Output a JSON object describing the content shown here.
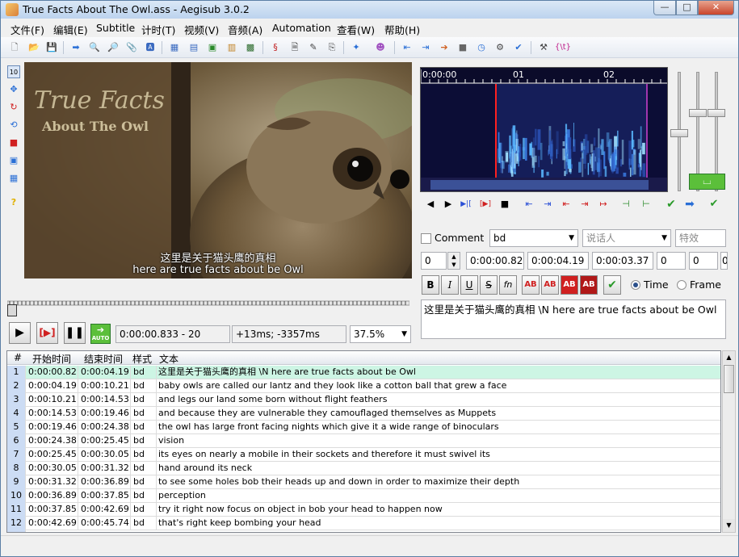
{
  "window": {
    "title": "True Facts About The Owl.ass - Aegisub 3.0.2"
  },
  "menu": [
    "文件(F)",
    "编辑(E)",
    "Subtitle",
    "计时(T)",
    "视频(V)",
    "音频(A)",
    "Automation",
    "查看(W)",
    "帮助(H)"
  ],
  "video": {
    "logo_line1": "True Facts",
    "logo_line2": "About The Owl",
    "subtitle_line1": "这里是关于猫头鹰的真相",
    "subtitle_line2": "here are true facts about be Owl",
    "time_display": "0:00:00.833 - 20",
    "offset_display": "+13ms; -3357ms",
    "zoom": "37.5%",
    "auto_label": "AUTO"
  },
  "audio": {
    "ticks": [
      "0:00:00",
      "01",
      "02"
    ]
  },
  "editor": {
    "comment_label": "Comment",
    "style": "bd",
    "actor_placeholder": "说话人",
    "effect_placeholder": "特效",
    "layer": "0",
    "start": "0:00:00.82",
    "end": "0:00:04.19",
    "duration": "0:00:03.37",
    "margin_l": "0",
    "margin_r": "0",
    "margin_v": "0",
    "bold": "B",
    "italic": "I",
    "underline": "U",
    "strike": "S",
    "font": "fn",
    "ab": "AB",
    "time_label": "Time",
    "frame_label": "Frame",
    "text": "这里是关于猫头鹰的真相 \\N here are true facts about be Owl"
  },
  "grid": {
    "headers": {
      "num": "#",
      "start": "开始时间",
      "end": "结束时间",
      "style": "样式",
      "text": "文本"
    },
    "rows": [
      {
        "num": "1",
        "start": "0:00:00.82",
        "end": "0:00:04.19",
        "style": "bd",
        "text": "这里是关于猫头鹰的真相 \\N here are true facts about be Owl"
      },
      {
        "num": "2",
        "start": "0:00:04.19",
        "end": "0:00:10.21",
        "style": "bd",
        "text": "baby owls are called our lantz and they look like a cotton ball that grew a face"
      },
      {
        "num": "3",
        "start": "0:00:10.21",
        "end": "0:00:14.53",
        "style": "bd",
        "text": "and legs our land some born without flight feathers"
      },
      {
        "num": "4",
        "start": "0:00:14.53",
        "end": "0:00:19.46",
        "style": "bd",
        "text": "and because they are vulnerable they camouflaged themselves as Muppets"
      },
      {
        "num": "5",
        "start": "0:00:19.46",
        "end": "0:00:24.38",
        "style": "bd",
        "text": "the owl has large front facing nights which give it a wide range of binoculars"
      },
      {
        "num": "6",
        "start": "0:00:24.38",
        "end": "0:00:25.45",
        "style": "bd",
        "text": "vision"
      },
      {
        "num": "7",
        "start": "0:00:25.45",
        "end": "0:00:30.05",
        "style": "bd",
        "text": "its eyes on nearly a mobile in their sockets and therefore it must swivel its"
      },
      {
        "num": "8",
        "start": "0:00:30.05",
        "end": "0:00:31.32",
        "style": "bd",
        "text": "hand around its neck"
      },
      {
        "num": "9",
        "start": "0:00:31.32",
        "end": "0:00:36.89",
        "style": "bd",
        "text": "to see some holes bob their heads up and down in order to maximize their depth"
      },
      {
        "num": "10",
        "start": "0:00:36.89",
        "end": "0:00:37.85",
        "style": "bd",
        "text": "perception"
      },
      {
        "num": "11",
        "start": "0:00:37.85",
        "end": "0:00:42.69",
        "style": "bd",
        "text": "try it right now focus on object in bob your head to happen now"
      },
      {
        "num": "12",
        "start": "0:00:42.69",
        "end": "0:00:45.74",
        "style": "bd",
        "text": "that's right keep bombing your head"
      }
    ]
  },
  "colors": {
    "grid_active_row": "#cdf5e4",
    "audio_bg": "#0c0d36",
    "accent_red": "#e03b3b"
  }
}
